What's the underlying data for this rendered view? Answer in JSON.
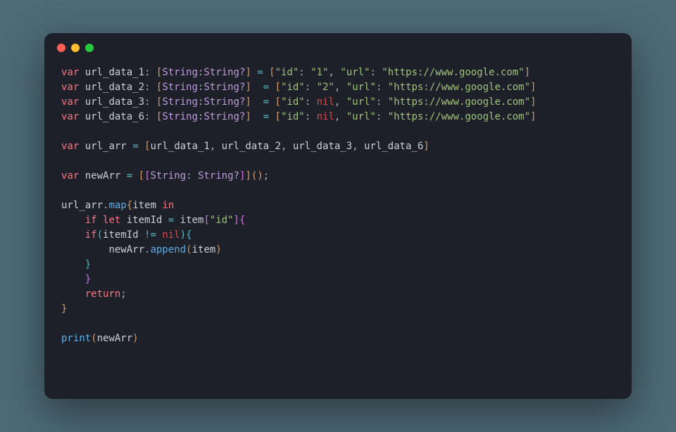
{
  "window": {
    "traffic_lights": [
      "close",
      "minimize",
      "zoom"
    ]
  },
  "code": {
    "vars": [
      {
        "name": "url_data_1",
        "type_l": "String",
        "type_r": "String?",
        "pad": "",
        "id_val": "\"1\"",
        "url_val": "\"https://www.google.com\""
      },
      {
        "name": "url_data_2",
        "type_l": "String",
        "type_r": "String?",
        "pad": " ",
        "id_val": "\"2\"",
        "url_val": "\"https://www.google.com\""
      },
      {
        "name": "url_data_3",
        "type_l": "String",
        "type_r": "String?",
        "pad": " ",
        "id_val": "nil",
        "url_val": "\"https://www.google.com\""
      },
      {
        "name": "url_data_6",
        "type_l": "String",
        "type_r": "String?",
        "pad": " ",
        "id_val": "nil",
        "url_val": "\"https://www.google.com\""
      }
    ],
    "arr_decl": {
      "kw": "var",
      "name": "url_arr",
      "items": [
        "url_data_1",
        "url_data_2",
        "url_data_3",
        "url_data_6"
      ]
    },
    "newarr_decl": {
      "kw": "var",
      "name": "newArr",
      "type_l": "String",
      "type_r": "String?"
    },
    "map_block": {
      "target": "url_arr",
      "fn": "map",
      "param": "item",
      "kw_in": "in",
      "if_kw": "if",
      "let_kw": "let",
      "bind": "itemId",
      "assign_from": "item",
      "key": "\"id\"",
      "cond_lhs": "itemId",
      "cond_op": "!=",
      "cond_rhs": "nil",
      "append_target": "newArr",
      "append_fn": "append",
      "append_arg": "item",
      "return_kw": "return"
    },
    "print": {
      "fn": "print",
      "arg": "newArr"
    }
  }
}
